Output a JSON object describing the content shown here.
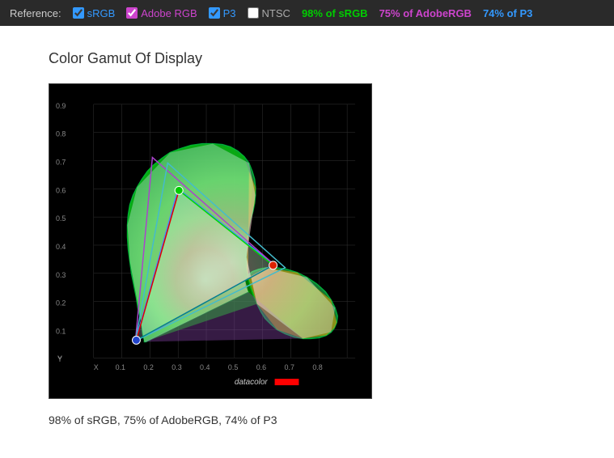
{
  "reference_bar": {
    "label": "Reference:",
    "items": [
      {
        "id": "srgb",
        "label": "sRGB",
        "checked": true,
        "color": "#3399ff"
      },
      {
        "id": "adobe",
        "label": "Adobe RGB",
        "checked": true,
        "color": "#cc44cc"
      },
      {
        "id": "p3",
        "label": "P3",
        "checked": true,
        "color": "#3399ff"
      },
      {
        "id": "ntsc",
        "label": "NTSC",
        "checked": false,
        "color": "#aaa"
      }
    ],
    "stats": {
      "srgb": "98% of sRGB",
      "adobe": "75% of AdobeRGB",
      "p3": "74% of P3"
    }
  },
  "page": {
    "title": "Color Gamut Of Display",
    "bottom_text": "98% of sRGB, 75% of AdobeRGB, 74% of P3"
  },
  "icons": {
    "datacolor_text": "datacolor"
  }
}
